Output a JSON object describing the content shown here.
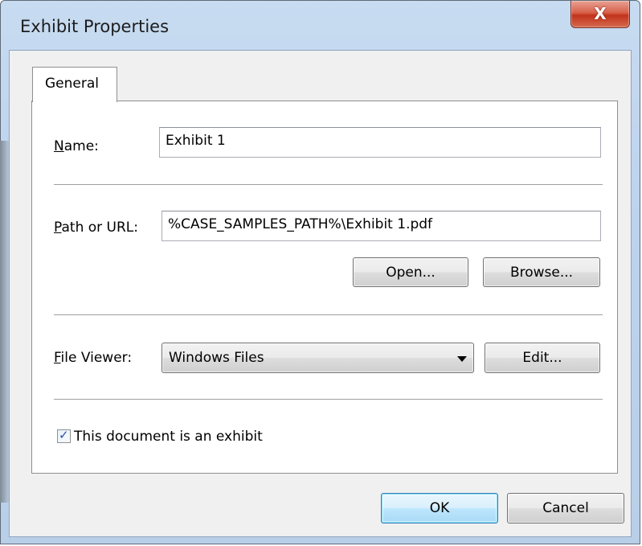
{
  "window": {
    "title": "Exhibit Properties",
    "close_glyph": "X"
  },
  "tabs": [
    {
      "label": "General",
      "selected": true
    }
  ],
  "form": {
    "name": {
      "label_accel": "N",
      "label_rest": "ame:",
      "value": "Exhibit 1"
    },
    "path": {
      "label_accel": "P",
      "label_rest": "ath or URL:",
      "value": "%CASE_SAMPLES_PATH%\\Exhibit 1.pdf",
      "open_label": "Open...",
      "browse_label": "Browse..."
    },
    "viewer": {
      "label_accel": "F",
      "label_rest": "ile Viewer:",
      "selected": "Windows Files",
      "edit_label": "Edit..."
    },
    "exhibit_checkbox": {
      "label": "This document is an exhibit",
      "checked": true
    }
  },
  "footer": {
    "ok_label": "OK",
    "cancel_label": "Cancel"
  },
  "colors": {
    "frame": "#bcd1ea",
    "close_button": "#c2331b",
    "default_button": "#3c7fb1"
  }
}
